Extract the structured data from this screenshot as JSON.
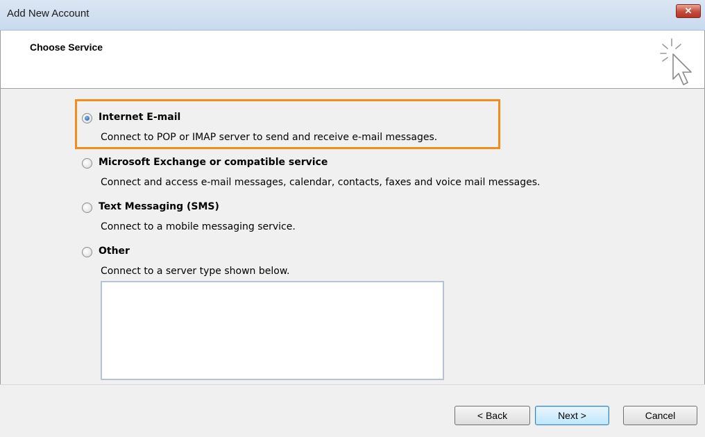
{
  "window": {
    "title": "Add New Account",
    "close_glyph": "✕"
  },
  "header": {
    "title": "Choose Service",
    "icon": "wizard-cursor-icon"
  },
  "options": [
    {
      "label": "Internet E-mail",
      "description": "Connect to POP or IMAP server to send and receive e-mail messages.",
      "selected": true
    },
    {
      "label": "Microsoft Exchange or compatible service",
      "description": "Connect and access e-mail messages, calendar, contacts, faxes and voice mail messages.",
      "selected": false
    },
    {
      "label": "Text Messaging (SMS)",
      "description": "Connect to a mobile messaging service.",
      "selected": false
    },
    {
      "label": "Other",
      "description": "Connect to a server type shown below.",
      "selected": false
    }
  ],
  "buttons": {
    "back": "< Back",
    "next": "Next >",
    "cancel": "Cancel"
  },
  "colors": {
    "highlight": "#f28c1a",
    "selected_radio": "#1c5aa8"
  }
}
